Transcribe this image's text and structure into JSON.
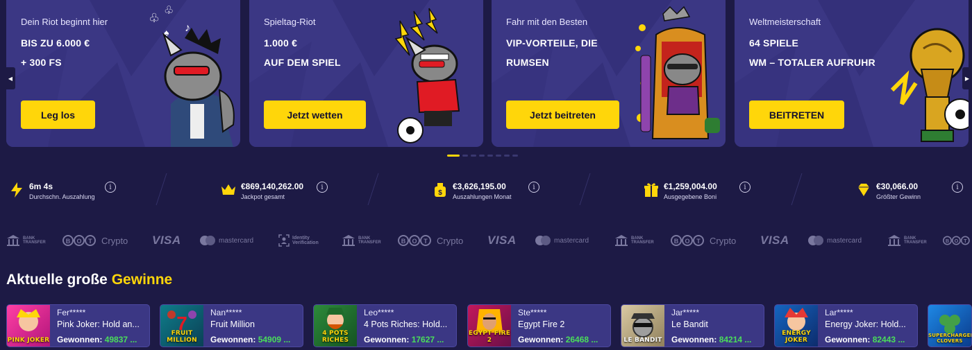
{
  "banners": [
    {
      "subtitle": "Dein Riot beginnt hier",
      "line1": "BIS ZU 6.000 €",
      "line2": "+ 300 FS",
      "cta": "Leg los"
    },
    {
      "subtitle": "Spieltag-Riot",
      "line1": "1.000 €",
      "line2": "AUF DEM SPIEL",
      "cta": "Jetzt wetten"
    },
    {
      "subtitle": "Fahr mit den Besten",
      "line1": "VIP-VORTEILE, DIE",
      "line2": "RUMSEN",
      "cta": "Jetzt beitreten"
    },
    {
      "subtitle": "Weltmeisterschaft",
      "line1": "64 SPIELE",
      "line2": "WM – TOTALER AUFRUHR",
      "cta": "BEITRETEN"
    }
  ],
  "carousel": {
    "prev": "◀",
    "next": "▶",
    "dot_count": 8,
    "active_dot": 0
  },
  "stats": [
    {
      "value": "6m 4s",
      "label": "Durchschn. Auszahlung",
      "icon": "lightning-icon"
    },
    {
      "value": "€869,140,262.00",
      "label": "Jackpot gesamt",
      "icon": "crown-icon"
    },
    {
      "value": "€3,626,195.00",
      "label": "Auszahlungen Monat",
      "icon": "money-bag-icon"
    },
    {
      "value": "€1,259,004.00",
      "label": "Ausgegebene Boni",
      "icon": "gift-icon"
    },
    {
      "value": "€30,066.00",
      "label": "Größter Gewinn",
      "icon": "diamond-icon"
    }
  ],
  "info_glyph": "i",
  "payments": {
    "bank_line1": "BANK",
    "bank_line2": "TRANSFER",
    "bot_label": "Crypto",
    "visa": "VISA",
    "mastercard": "mastercard",
    "idv_line1": "Identity",
    "idv_line2": "Verification"
  },
  "wins": {
    "title_prefix": "Aktuelle große",
    "title_highlight": "Gewinne",
    "won_label": "Gewonnen:",
    "items": [
      {
        "user": "Fer*****",
        "game": "Pink Joker: Hold an...",
        "amount": "49837 ...",
        "thumb": "PINK JOKER"
      },
      {
        "user": "Nan*****",
        "game": "Fruit Million",
        "amount": "54909 ...",
        "thumb": "FRUIT MILLION"
      },
      {
        "user": "Leo*****",
        "game": "4 Pots Riches: Hold...",
        "amount": "17627 ...",
        "thumb": "4 POTS RICHES"
      },
      {
        "user": "Ste*****",
        "game": "Egypt Fire 2",
        "amount": "26468 ...",
        "thumb": "EGYPT FIRE 2"
      },
      {
        "user": "Jar*****",
        "game": "Le Bandit",
        "amount": "84214 ...",
        "thumb": "LE BANDIT"
      },
      {
        "user": "Lar*****",
        "game": "Energy Joker: Hold...",
        "amount": "82443 ...",
        "thumb": "ENERGY JOKER"
      },
      {
        "user": "",
        "game": "",
        "amount": "",
        "thumb": "SUPERCHARGED CLOVERS"
      }
    ]
  },
  "colors": {
    "accent": "#ffd60a",
    "card": "#3b3784",
    "bg": "#1d1a45",
    "win_green": "#4ade5a"
  }
}
